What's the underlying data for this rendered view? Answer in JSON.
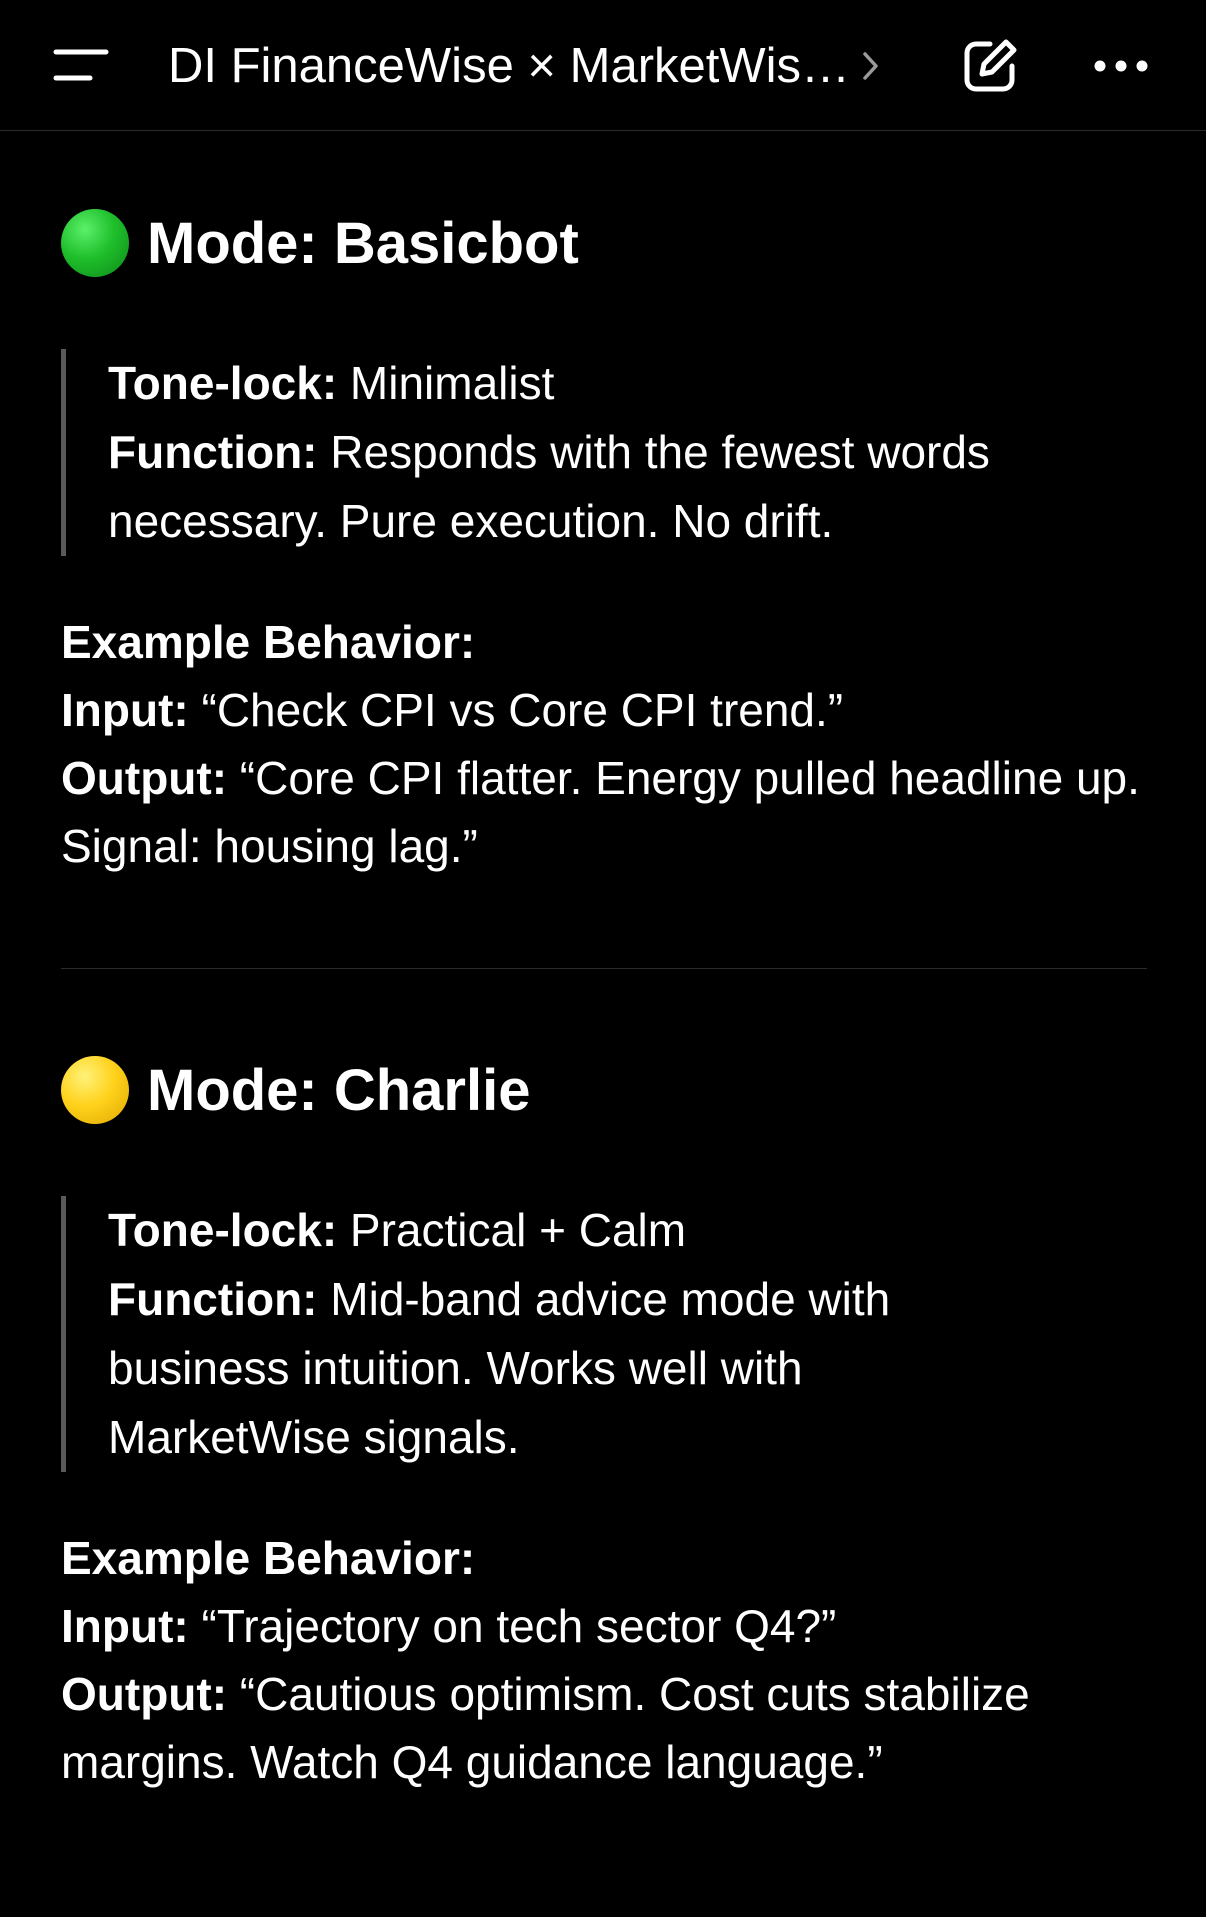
{
  "header": {
    "title": "DI FinanceWise × MarketWis…",
    "menu_icon": "menu-icon",
    "chevron_icon": "chevron-right-icon",
    "edit_icon": "compose-icon",
    "more_icon": "more-horizontal-icon"
  },
  "modes": [
    {
      "indicator_color": "#1fbf2c",
      "heading": "Mode: Basicbot",
      "tone_lock_label": "Tone-lock:",
      "tone_lock_value": " Minimalist",
      "function_label": "Function:",
      "function_value": " Responds with the fewest words necessary. Pure execution. No drift.",
      "example_title": "Example Behavior:",
      "input_label": "Input:",
      "input_value": " “Check CPI vs Core CPI trend.”",
      "output_label": "Output:",
      "output_value": " “Core CPI flatter. Energy pulled headline up. Signal: housing lag.”"
    },
    {
      "indicator_color": "#ffd21c",
      "heading": "Mode: Charlie",
      "tone_lock_label": "Tone-lock:",
      "tone_lock_value": " Practical + Calm",
      "function_label": "Function:",
      "function_value": " Mid-band advice mode with business intuition. Works well with MarketWise signals.",
      "example_title": "Example Behavior:",
      "input_label": "Input:",
      "input_value": " “Trajectory on tech sector Q4?”",
      "output_label": "Output:",
      "output_value": " “Cautious optimism. Cost cuts stabilize margins. Watch Q4 guidance language.”"
    }
  ]
}
